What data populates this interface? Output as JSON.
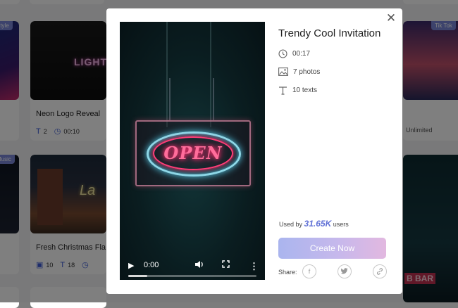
{
  "background": {
    "card_left_top_tag": "Style",
    "card_neon": {
      "thumb_text": "LIGHT",
      "title": "Neon Logo Reveal",
      "texts": "2",
      "duration": "00:10"
    },
    "card_left_mid_tag": "Music",
    "card_christmas": {
      "title": "Fresh Christmas Fla",
      "photos": "10",
      "texts": "18"
    },
    "card_right_top": {
      "tag": "Tik Tok",
      "label": "Unlimited"
    },
    "card_right_mid": {
      "thumb_text": "B BAR"
    }
  },
  "modal": {
    "title": "Trendy Cool Invitation",
    "duration": "00:17",
    "photos": "7 photos",
    "texts": "10 texts",
    "used_prefix": "Used by",
    "used_count": "31.65K",
    "used_suffix": "users",
    "create_button": "Create Now",
    "share_label": "Share:",
    "share_icons": [
      "facebook-icon",
      "twitter-icon",
      "link-icon"
    ],
    "video": {
      "sign_text": "OPEN",
      "time": "0:00",
      "progress": 0.15
    }
  },
  "colors": {
    "accent": "#5f70d6",
    "button_start": "#aab5ee",
    "button_end": "#e2b8e0",
    "overlay": "rgba(0,0,0,0.5)"
  }
}
